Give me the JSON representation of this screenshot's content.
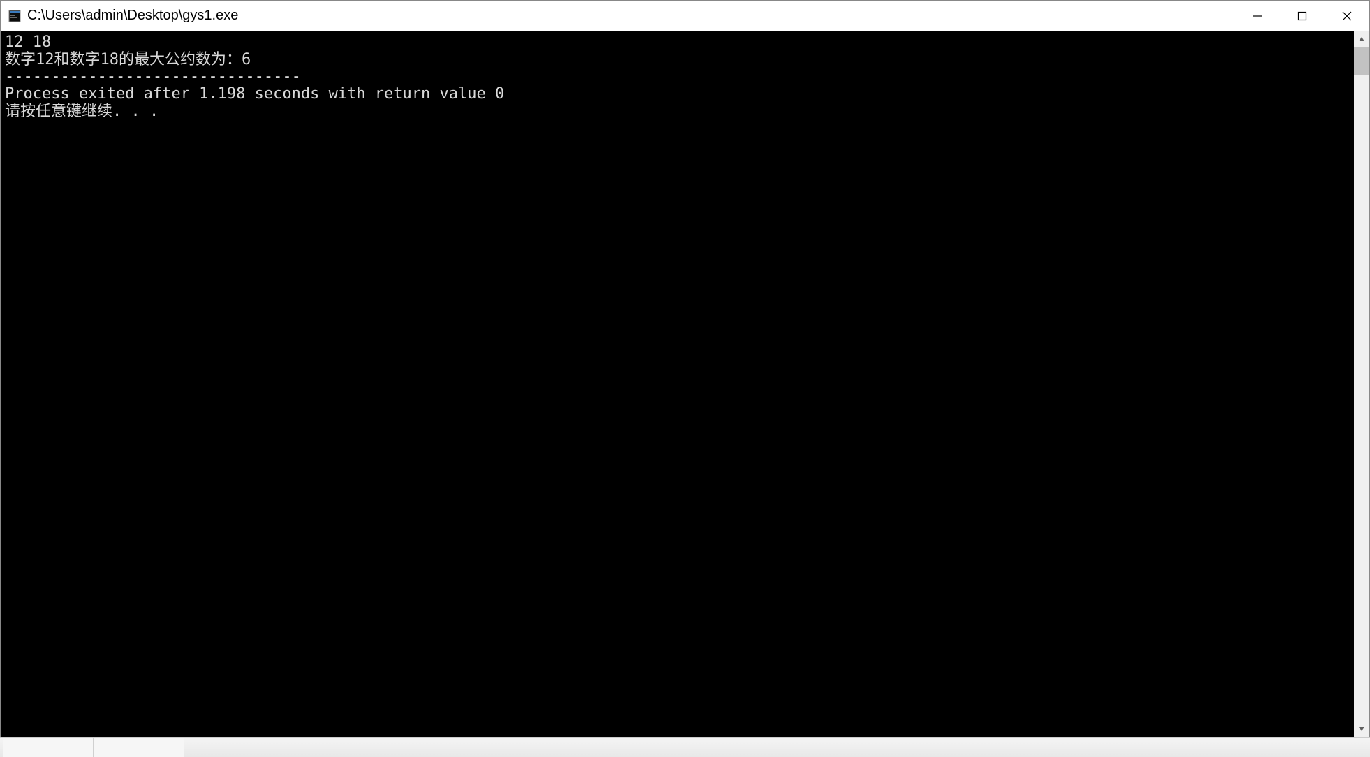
{
  "window": {
    "title": "C:\\Users\\admin\\Desktop\\gys1.exe"
  },
  "console": {
    "lines": [
      "12 18",
      "数字12和数字18的最大公约数为：6",
      "--------------------------------",
      "Process exited after 1.198 seconds with return value 0",
      "请按任意键继续. . ."
    ]
  }
}
